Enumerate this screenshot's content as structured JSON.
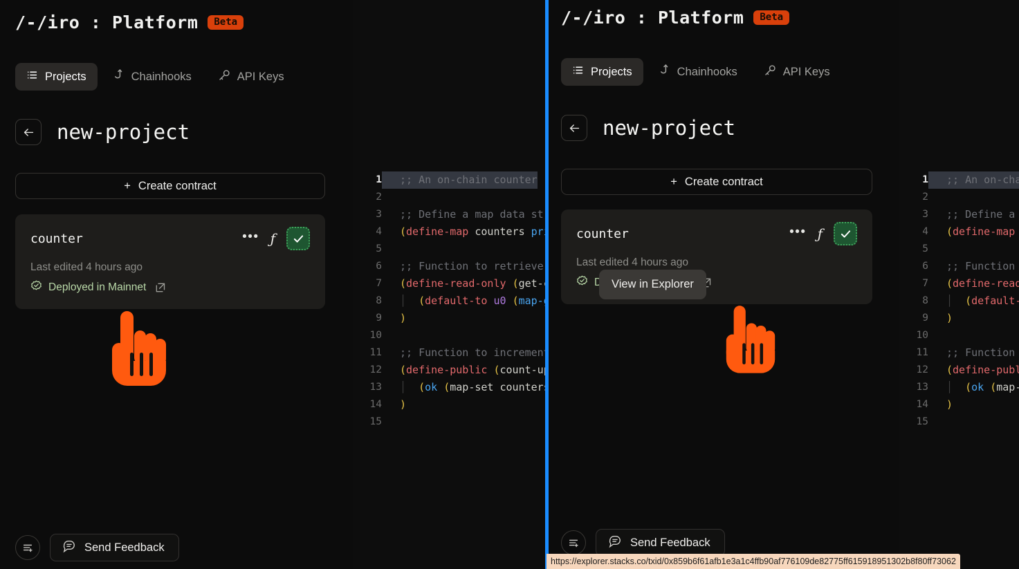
{
  "app": {
    "brand": "/-/iro : Platform",
    "beta_badge": "Beta",
    "accent_orange": "#d9400b",
    "divider_color": "#1a8cff",
    "cursor_color": "#ff5a0f"
  },
  "tabs": [
    {
      "label": "Projects",
      "icon": "list-icon",
      "active": true
    },
    {
      "label": "Chainhooks",
      "icon": "hook-icon",
      "active": false
    },
    {
      "label": "API Keys",
      "icon": "key-icon",
      "active": false
    }
  ],
  "project": {
    "back_label": "Back",
    "title": "new-project",
    "create_contract_label": "Create contract",
    "create_contract_plus": "+"
  },
  "contract_card": {
    "name": "counter",
    "menu_label": "•••",
    "function_label": "ƒ",
    "check_label": "✓",
    "last_edited": "Last edited 4 hours ago",
    "status": "Deployed in Mainnet",
    "status_color": "#b9d8a8",
    "external_link_name": "external-link-icon"
  },
  "tooltip": {
    "text": "View in Explorer",
    "background": "#3b3936"
  },
  "footer": {
    "menu_icon": "list-plus-icon",
    "feedback_label": "Send Feedback",
    "feedback_icon": "message-icon"
  },
  "status_bar": {
    "url": "https://explorer.stacks.co/txid/0x859b6f61afb1e3a1c4ffb90af776109de82775ff615918951302b8f80ff73062"
  },
  "editor": {
    "lines": [
      {
        "n": "1",
        "selected": true,
        "current": true,
        "tokens": [
          {
            "t": ";; An on-chain counter",
            "c": "t-com"
          }
        ]
      },
      {
        "n": "2",
        "selected": false,
        "current": false,
        "tokens": []
      },
      {
        "n": "3",
        "selected": false,
        "current": false,
        "tokens": [
          {
            "t": ";; Define a map data structure",
            "c": "t-com"
          }
        ]
      },
      {
        "n": "4",
        "selected": false,
        "current": false,
        "tokens": [
          {
            "t": "(",
            "c": "t-par"
          },
          {
            "t": "define-map",
            "c": "t-key"
          },
          {
            "t": " counters ",
            "c": "t-plain"
          },
          {
            "t": "principal",
            "c": "t-blue"
          }
        ]
      },
      {
        "n": "5",
        "selected": false,
        "current": false,
        "tokens": []
      },
      {
        "n": "6",
        "selected": false,
        "current": false,
        "tokens": [
          {
            "t": ";; Function to retrieve the",
            "c": "t-com"
          }
        ]
      },
      {
        "n": "7",
        "selected": false,
        "current": false,
        "tokens": [
          {
            "t": "(",
            "c": "t-par"
          },
          {
            "t": "define-read-only",
            "c": "t-key"
          },
          {
            "t": " ",
            "c": "t-plain"
          },
          {
            "t": "(",
            "c": "t-par"
          },
          {
            "t": "get-count",
            "c": "t-plain"
          }
        ]
      },
      {
        "n": "8",
        "selected": false,
        "current": false,
        "indent": true,
        "tokens": [
          {
            "t": "  (",
            "c": "t-par"
          },
          {
            "t": "default-to",
            "c": "t-key"
          },
          {
            "t": " ",
            "c": "t-plain"
          },
          {
            "t": "u0",
            "c": "t-pur"
          },
          {
            "t": " ",
            "c": "t-plain"
          },
          {
            "t": "(",
            "c": "t-par"
          },
          {
            "t": "map-get",
            "c": "t-blue"
          }
        ]
      },
      {
        "n": "9",
        "selected": false,
        "current": false,
        "tokens": [
          {
            "t": ")",
            "c": "t-par"
          }
        ]
      },
      {
        "n": "10",
        "selected": false,
        "current": false,
        "tokens": []
      },
      {
        "n": "11",
        "selected": false,
        "current": false,
        "tokens": [
          {
            "t": ";; Function to increment the",
            "c": "t-com"
          }
        ]
      },
      {
        "n": "12",
        "selected": false,
        "current": false,
        "tokens": [
          {
            "t": "(",
            "c": "t-par"
          },
          {
            "t": "define-public",
            "c": "t-key"
          },
          {
            "t": " ",
            "c": "t-plain"
          },
          {
            "t": "(",
            "c": "t-par"
          },
          {
            "t": "count-up",
            "c": "t-plain"
          }
        ]
      },
      {
        "n": "13",
        "selected": false,
        "current": false,
        "indent": true,
        "tokens": [
          {
            "t": "  (",
            "c": "t-par"
          },
          {
            "t": "ok",
            "c": "t-blue"
          },
          {
            "t": " ",
            "c": "t-plain"
          },
          {
            "t": "(",
            "c": "t-par"
          },
          {
            "t": "map-set",
            "c": "t-plain"
          },
          {
            "t": " counters",
            "c": "t-plain"
          }
        ]
      },
      {
        "n": "14",
        "selected": false,
        "current": false,
        "tokens": [
          {
            "t": ")",
            "c": "t-par"
          }
        ]
      },
      {
        "n": "15",
        "selected": false,
        "current": false,
        "tokens": []
      }
    ]
  }
}
